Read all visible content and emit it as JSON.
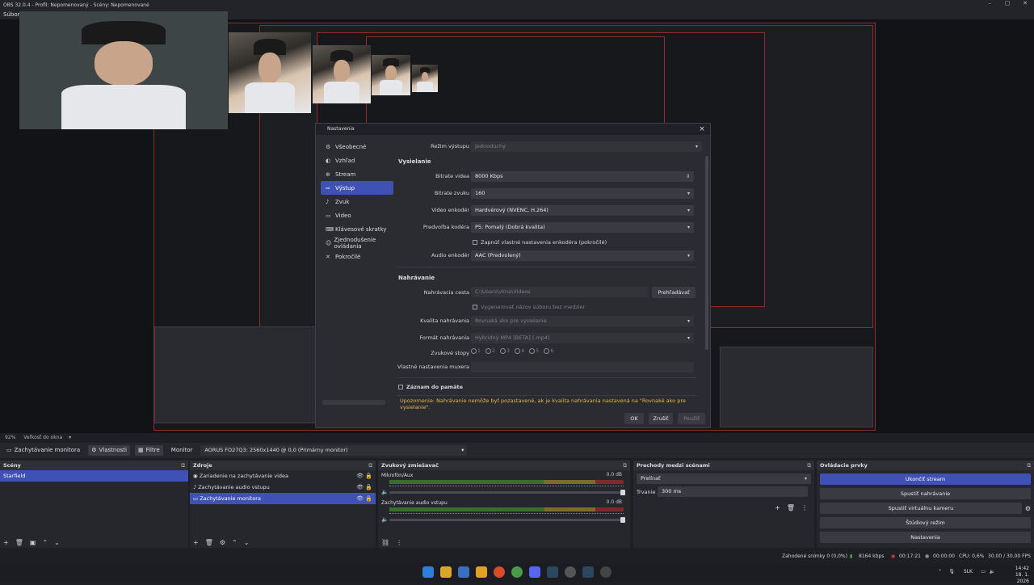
{
  "window": {
    "title": "OBS 32.0.4 - Profil: Nepomenovaný - Scény: Nepomenované",
    "menu": "Súbor"
  },
  "preview": {
    "zoom": "92%",
    "zoom_mode": "Veľkosť do okna"
  },
  "dialog": {
    "title": "Nastavenia",
    "nav": [
      "Všeobecné",
      "Vzhľad",
      "Stream",
      "Výstup",
      "Zvuk",
      "Video",
      "Klávesové skratky",
      "Zjednodušenie ovládania",
      "Pokročilé"
    ],
    "nav_icons": [
      "gear-icon",
      "palette-icon",
      "globe-icon",
      "output-icon",
      "volume-icon",
      "monitor-icon",
      "keyboard-icon",
      "accessibility-icon",
      "wrench-icon"
    ],
    "active_nav": 3,
    "output_mode_label": "Režim výstupu",
    "output_mode_value": "Jednoduchý",
    "streaming_section": "Vysielanie",
    "video_bitrate_label": "Bitrate videa",
    "video_bitrate_value": "8000 Kbps",
    "audio_bitrate_label": "Bitrate zvuku",
    "audio_bitrate_value": "160",
    "video_encoder_label": "Video enkodér",
    "video_encoder_value": "Hardvérový (NVENC, H.264)",
    "encoder_preset_label": "Predvoľba kodéra",
    "encoder_preset_value": "P5: Pomalý (Dobrá kvalita)",
    "custom_encoder_label": "Zapnúť vlastné nastavenia enkodéra (pokročilé)",
    "audio_encoder_label": "Audio enkodér",
    "audio_encoder_value": "AAC (Predvolený)",
    "recording_section": "Nahrávanie",
    "recording_path_label": "Nahrávacia cesta",
    "recording_path_value": "C:\\Users\\vkna\\Videos",
    "browse_button": "Prehľadávať",
    "no_space_label": "Vygenerovať názov súboru bez medzier",
    "rec_quality_label": "Kvalita nahrávania",
    "rec_quality_value": "Rovnaká ako pre vysielanie",
    "rec_format_label": "Formát nahrávania",
    "rec_format_value": "Hybridný MP4 [BETA] (.mp4)",
    "audio_tracks_label": "Zvukové stopy",
    "audio_tracks": [
      "1",
      "2",
      "3",
      "4",
      "5",
      "6"
    ],
    "custom_muxer_label": "Vlastné nastavenia muxera",
    "replay_buffer_label": "Záznam do pamäte",
    "warning": "Upozornenie: Nahrávanie nemôže byť pozastavené, ak je kvalita nahrávania nastavená na \"Rovnaké ako pre vysielanie\".",
    "ok_button": "OK",
    "cancel_button": "Zrušiť",
    "apply_button": "Použiť"
  },
  "source_toolbar": {
    "source_name": "Zachytávanie monitora",
    "properties": "Vlastnosti",
    "filters": "Filtre",
    "monitor_label": "Monitor",
    "monitor_value": "AORUS FO27Q3: 2560x1440 @ 0,0 (Primárny monitor)"
  },
  "scenes": {
    "title": "Scény",
    "items": [
      "Starfield"
    ]
  },
  "sources": {
    "title": "Zdroje",
    "items": [
      "Zariadenie na zachytávanie videa",
      "Zachytávanie audio vstupu",
      "Zachytávanie monitora"
    ]
  },
  "mixer": {
    "title": "Zvukový zmiešavač",
    "channels": [
      {
        "name": "Mikrofón/Aux",
        "db": "0.0 dB"
      },
      {
        "name": "Zachytávanie audio vstupu",
        "db": "0.0 dB"
      }
    ]
  },
  "transitions": {
    "title": "Prechody medzi scénami",
    "type": "Prelínať",
    "duration_label": "Trvanie",
    "duration_value": "300 ms"
  },
  "controls": {
    "title": "Ovládacie prvky",
    "buttons": [
      "Ukončiť stream",
      "Spustiť nahrávanie",
      "Spustiť virtuálnu kameru",
      "Štúdiový režim",
      "Nastavenia"
    ]
  },
  "statusbar": {
    "dropped": "Zahodené snímky 0 (0,0%)",
    "bitrate": "8164 kbps",
    "stream_time": "00:17:21",
    "rec_time": "00:00:00",
    "cpu": "CPU: 0,6%",
    "fps": "30.00 / 30.00 FPS"
  },
  "taskbar": {
    "lang": "SLK",
    "time": "14:42",
    "date": "18. 1. 2026"
  },
  "colors": {
    "accent": "#3f51b5",
    "warning": "#e6b84a",
    "preview_border": "#8e2b2b"
  }
}
